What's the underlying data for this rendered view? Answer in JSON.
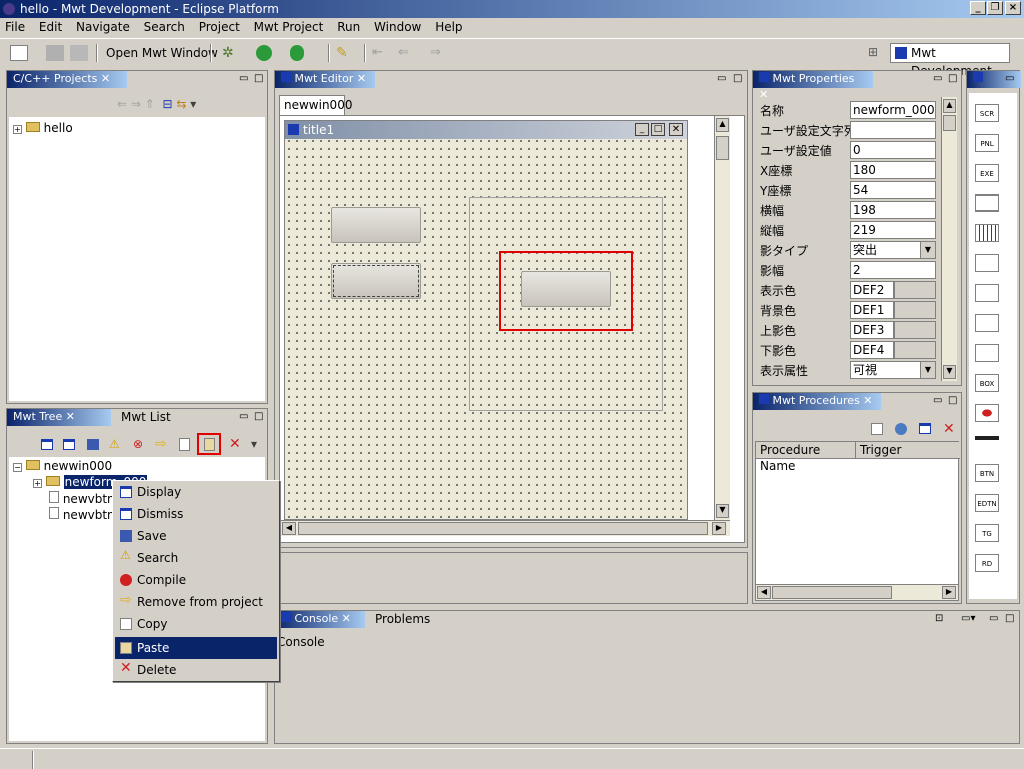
{
  "window": {
    "title": "hello - Mwt Development - Eclipse Platform"
  },
  "menu": [
    "File",
    "Edit",
    "Navigate",
    "Search",
    "Project",
    "Mwt Project",
    "Run",
    "Window",
    "Help"
  ],
  "toolbar": {
    "open_mwt_window": "Open Mwt Window",
    "perspective": "Mwt Development"
  },
  "projects_view": {
    "tab": "C/C++ Projects",
    "items": [
      "hello"
    ]
  },
  "tree_view": {
    "tab_active": "Mwt Tree",
    "tab_other": "Mwt List",
    "items": [
      "newwin000",
      "newform_000",
      "newvbtn_",
      "newvbtn_"
    ]
  },
  "editor": {
    "tab": "Mwt Editor",
    "sub_tab": "newwin000",
    "form_title": "title1"
  },
  "properties": {
    "tab": "Mwt Properties",
    "rows": [
      {
        "label": "名称",
        "value": "newform_000"
      },
      {
        "label": "ユーザ設定文字列",
        "value": ""
      },
      {
        "label": "ユーザ設定値",
        "value": "0"
      },
      {
        "label": "X座標",
        "value": "180"
      },
      {
        "label": "Y座標",
        "value": "54"
      },
      {
        "label": "横幅",
        "value": "198"
      },
      {
        "label": "縦幅",
        "value": "219"
      },
      {
        "label": "影タイプ",
        "value": "突出"
      },
      {
        "label": "影幅",
        "value": "2"
      },
      {
        "label": "表示色",
        "value": "DEF2"
      },
      {
        "label": "背景色",
        "value": "DEF1"
      },
      {
        "label": "上影色",
        "value": "DEF3"
      },
      {
        "label": "下影色",
        "value": "DEF4"
      },
      {
        "label": "表示属性",
        "value": "可視"
      }
    ]
  },
  "procedures": {
    "tab": "Mwt Procedures",
    "col1": "Procedure Name",
    "col2": "Trigger"
  },
  "console": {
    "tab": "Console",
    "tab_other": "Problems",
    "label": "Console"
  },
  "context_menu": {
    "items": [
      {
        "label": "Display",
        "icon": "window-icon"
      },
      {
        "label": "Dismiss",
        "icon": "window-icon"
      },
      {
        "label": "Save",
        "icon": "save-icon"
      },
      {
        "label": "Search",
        "icon": "warning-icon"
      },
      {
        "label": "Compile",
        "icon": "error-icon"
      },
      {
        "label": "Remove from project",
        "icon": "arrow-icon"
      },
      {
        "label": "Copy",
        "icon": "copy-icon"
      },
      {
        "label": "Paste",
        "icon": "paste-icon"
      },
      {
        "label": "Delete",
        "icon": "delete-icon"
      }
    ],
    "selected": "Paste"
  },
  "palette": [
    "SCR",
    "PNL",
    "EXE",
    "",
    "",
    "",
    "",
    "",
    "",
    "BOX",
    "",
    "",
    "BTN",
    "EDTN",
    "TG",
    "RD"
  ],
  "colors": {
    "accent": "#0a246a",
    "highlight_red": "#e00000"
  }
}
